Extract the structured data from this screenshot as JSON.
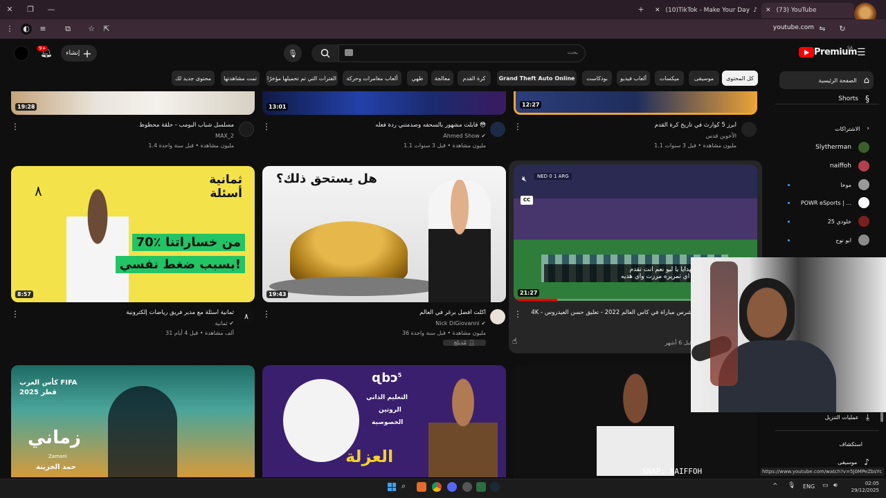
{
  "browser": {
    "tabs": [
      {
        "label": "(10)TikTok - Make Your Day",
        "active": false
      },
      {
        "label": "(73) YouTube",
        "active": true
      }
    ],
    "url": "youtube.com",
    "status_url": "https://www.youtube.com/watch?v=5J0MPeZbsYc"
  },
  "youtube": {
    "logo": "Premium",
    "region": "SA",
    "search_placeholder": "بحث",
    "create_label": "إنشاء",
    "notification_count": "9+",
    "chips": [
      "كل المحتوى",
      "موسيقى",
      "ميكسات",
      "ألعاب فيديو",
      "بودكاست",
      "Grand Theft Auto Online",
      "كرة القدم",
      "معالجة",
      "طهي",
      "ألعاب مغامرات وحركة",
      "الفترات التي تم تحميلها مؤخرًا",
      "تمت مشاهدتها",
      "محتوى جديد لك"
    ]
  },
  "sidebar": {
    "home": "الصفحة الرئيسية",
    "shorts": "Shorts",
    "subscriptions": "الاشتراكات",
    "channels": [
      "Slytherman",
      "naiffoh",
      "موحا",
      "POWR eSports | ...",
      "خلودي 25",
      "ابو نوح"
    ],
    "downloads": "عمليات التنزيل",
    "explore": "استكشاف",
    "music": "موسيقى"
  },
  "videos_row1": [
    {
      "title": "مسلسل شباب البومب - حلقة محظوظ",
      "channel": "MAX_2",
      "meta": "1.4 مليون مشاهدة • قبل سنة واحدة",
      "duration": "19:28"
    },
    {
      "title": "قابلت مشهور بالسحفه وصدمتني ردة فعله 😳",
      "channel": "Ahmed Show",
      "meta": "1.1 مليون مشاهدة • قبل 3 سنوات",
      "duration": "13:01"
    },
    {
      "title": "أبرز 5 كوارث في تاريخ كرة القدم",
      "channel": "الأخوين قدس",
      "meta": "1.1 مليون مشاهدة • قبل 3 سنوات",
      "duration": "12:27"
    }
  ],
  "videos_row2": [
    {
      "title": "ثمانية أسئلة مع مدير فريق رياضات إلكترونية",
      "channel": "ثمانية",
      "meta": "31 ألف مشاهدة • قبل 4 أيام",
      "duration": "8:57",
      "thumb_text1": "ثمانية أسئلة",
      "thumb_text2": "70٪ من خساراتنا",
      "thumb_text3": "بسبب ضغط نفسي!"
    },
    {
      "title": "أكلت أفضل برغر في العالم",
      "channel": "Nick DiGiovanni",
      "meta": "36 مليون مشاهدة • قبل سنة واحدة",
      "badge": "مُدبلج",
      "duration": "19:43",
      "thumb_text1": "هل يستحق ذلك؟"
    },
    {
      "title": "4K - أشرس مباراة في كأس العالم 2022 - تعليق حسن العيدروس",
      "meta": "قبل 6 أشهر",
      "duration": "21:27",
      "caption_line1": "انت تقدم الهدايا يا ليو نعم انت تقدم",
      "caption_line2": "الهدايا يا ليو اي تمريره مررت واي هديه",
      "cc": "CC",
      "score_bar": "NED 0 1 ARG"
    }
  ],
  "videos_row3": [
    {
      "thumb_text1": "كأس العرب FIFA",
      "thumb_text2": "قطر 2025",
      "thumb_text3": "زماني",
      "thumb_text4": "Zamani",
      "thumb_text5": "حمد الخزينة"
    },
    {
      "thumb_text1": "التعليم الذاتي",
      "thumb_text2": "الروتين",
      "thumb_text3": "الخصوصية",
      "thumb_text4": "العزلة",
      "thumb_text5": "5"
    }
  ],
  "overlay": {
    "snap_text": "SNAP: NAIFFOH"
  },
  "taskbar": {
    "lang": "ENG",
    "time": "02:05",
    "date": "29/12/2025"
  },
  "colors": {
    "yt_red": "#ff0000",
    "accent_blue": "#3ea6ff",
    "bg": "#0f0f0f"
  }
}
